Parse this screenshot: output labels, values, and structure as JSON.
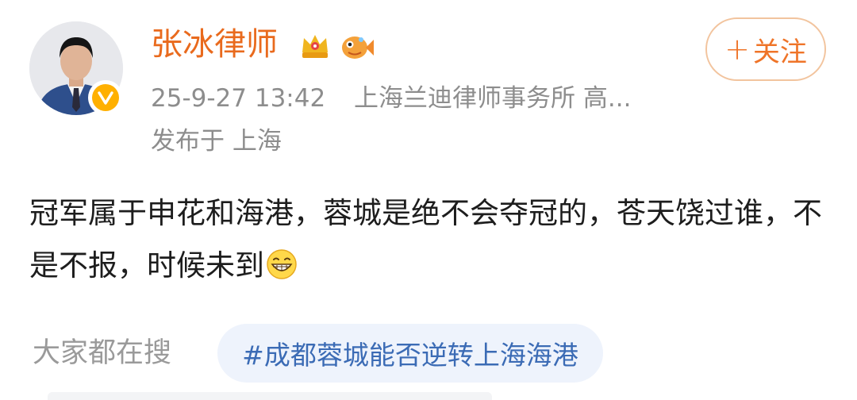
{
  "user": {
    "name": "张冰律师",
    "badges": [
      "crown-badge-icon",
      "fish-badge-icon"
    ],
    "verified_icon": "verified-v-icon"
  },
  "follow_button": {
    "plus": "+",
    "label": "关注"
  },
  "post_meta": {
    "timestamp": "25-9-27 13:42",
    "source": "上海兰迪律师事务所 高...",
    "location": "发布于 上海"
  },
  "post": {
    "text": "冠军属于申花和海港，蓉城是绝不会夺冠的，苍天饶过谁，不是不报，时候未到",
    "emoji": "grin-emoji-icon"
  },
  "search": {
    "label": "大家都在搜",
    "topic": "#成都蓉城能否逆转上海海港"
  },
  "colors": {
    "name": "#e96a1d",
    "follow": "#ef7428",
    "meta": "#8d8d8d",
    "topic": "#3b6bb5",
    "topic_bg": "#eef3fc"
  }
}
